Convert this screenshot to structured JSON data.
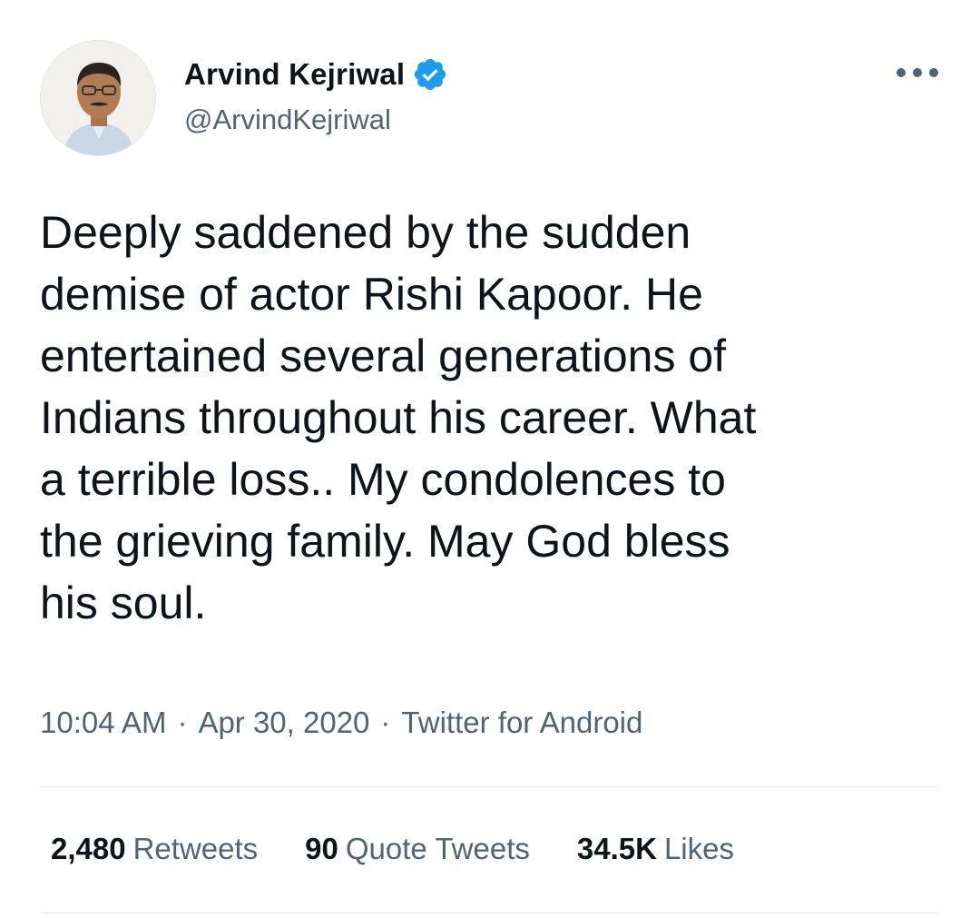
{
  "author": {
    "display_name": "Arvind Kejriwal",
    "handle": "@ArvindKejriwal",
    "verified_icon": "verified-badge-icon",
    "avatar": "avatar-photo"
  },
  "menu": {
    "icon": "more-options-icon"
  },
  "tweet": {
    "text": "Deeply saddened by the sudden\ndemise of actor Rishi Kapoor. He\nentertained several generations of\nIndians throughout his career. What\na terrible loss.. My condolences to\nthe grieving family. May God bless\nhis soul."
  },
  "meta": {
    "time": "10:04 AM",
    "separator": "·",
    "date": "Apr 30, 2020",
    "source": "Twitter for Android"
  },
  "stats": {
    "retweets_count": "2,480",
    "retweets_label": "Retweets",
    "quotes_count": "90",
    "quotes_label": "Quote Tweets",
    "likes_count": "34.5K",
    "likes_label": "Likes"
  },
  "colors": {
    "text_primary": "#0f1419",
    "text_secondary": "#536471",
    "verified_blue": "#1d9bf0",
    "divider": "#e6ecf0"
  }
}
